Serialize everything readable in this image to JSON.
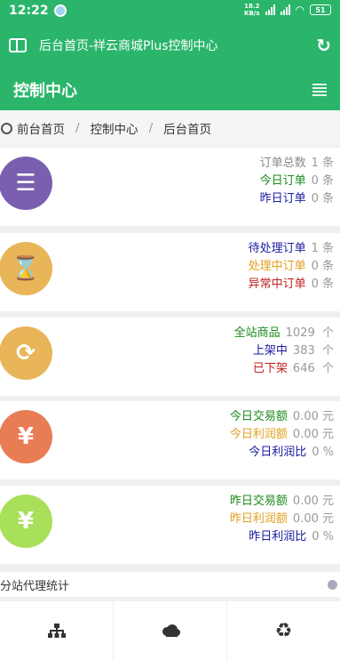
{
  "status": {
    "time": "12:22",
    "speed_top": "18.2",
    "speed_bottom": "KB/s",
    "battery": "51"
  },
  "browser": {
    "url_title": "后台首页-祥云商城Plus控制中心",
    "reload_icon": "reload-icon",
    "book_icon": "book-icon"
  },
  "header": {
    "title": "控制中心"
  },
  "breadcrumb": {
    "items": [
      "前台首页",
      "控制中心",
      "后台首页"
    ],
    "sep": "/"
  },
  "colors": {
    "green": "#2ab56b",
    "purple": "#7a5fb0",
    "gold": "#e8b659",
    "orange": "#e87d55",
    "lime": "#a8e05a"
  },
  "cards": [
    {
      "icon": "ordered-list-icon",
      "color": "#7a5fb0",
      "symbol": "☰",
      "rows": [
        {
          "label": "订单总数",
          "value": "1 条",
          "color": "#888888"
        },
        {
          "label": "今日订单",
          "value": "0 条",
          "color": "#1a8a1a"
        },
        {
          "label": "昨日订单",
          "value": "0 条",
          "color": "#1a1aa0"
        }
      ]
    },
    {
      "icon": "hourglass-icon",
      "color": "#e8b659",
      "symbol": "⌛",
      "rows": [
        {
          "label": "待处理订单",
          "value": "1 条",
          "color": "#1a1aa0"
        },
        {
          "label": "处理中订单",
          "value": "0 条",
          "color": "#e0a020"
        },
        {
          "label": "异常中订单",
          "value": "0 条",
          "color": "#c02020"
        }
      ]
    },
    {
      "icon": "refresh-icon",
      "color": "#e8b659",
      "symbol": "⟳",
      "rows": [
        {
          "label": "全站商品",
          "value": "1029  个",
          "color": "#1a8a1a"
        },
        {
          "label": "上架中",
          "value": "383  个",
          "color": "#1a1aa0"
        },
        {
          "label": "已下架",
          "value": "646  个",
          "color": "#c02020"
        }
      ]
    },
    {
      "icon": "yen-icon",
      "color": "#e87d55",
      "symbol": "¥",
      "rows": [
        {
          "label": "今日交易额",
          "value": "0.00 元",
          "color": "#1a8a1a"
        },
        {
          "label": "今日利润额",
          "value": "0.00 元",
          "color": "#e0a020"
        },
        {
          "label": "今日利润比",
          "value": "0 %",
          "color": "#1a1aa0"
        }
      ]
    },
    {
      "icon": "yen-icon",
      "color": "#a8e05a",
      "symbol": "¥",
      "rows": [
        {
          "label": "昨日交易额",
          "value": "0.00 元",
          "color": "#1a8a1a"
        },
        {
          "label": "昨日利润额",
          "value": "0.00 元",
          "color": "#e0a020"
        },
        {
          "label": "昨日利润比",
          "value": "0 %",
          "color": "#1a1aa0"
        }
      ]
    }
  ],
  "proxy": {
    "title": "分站代理统计"
  },
  "bottom_nav": [
    {
      "icon": "sitemap-icon",
      "symbol": "品"
    },
    {
      "icon": "cloud-icon",
      "symbol": "☁"
    },
    {
      "icon": "recycle-icon",
      "symbol": "♻"
    }
  ]
}
